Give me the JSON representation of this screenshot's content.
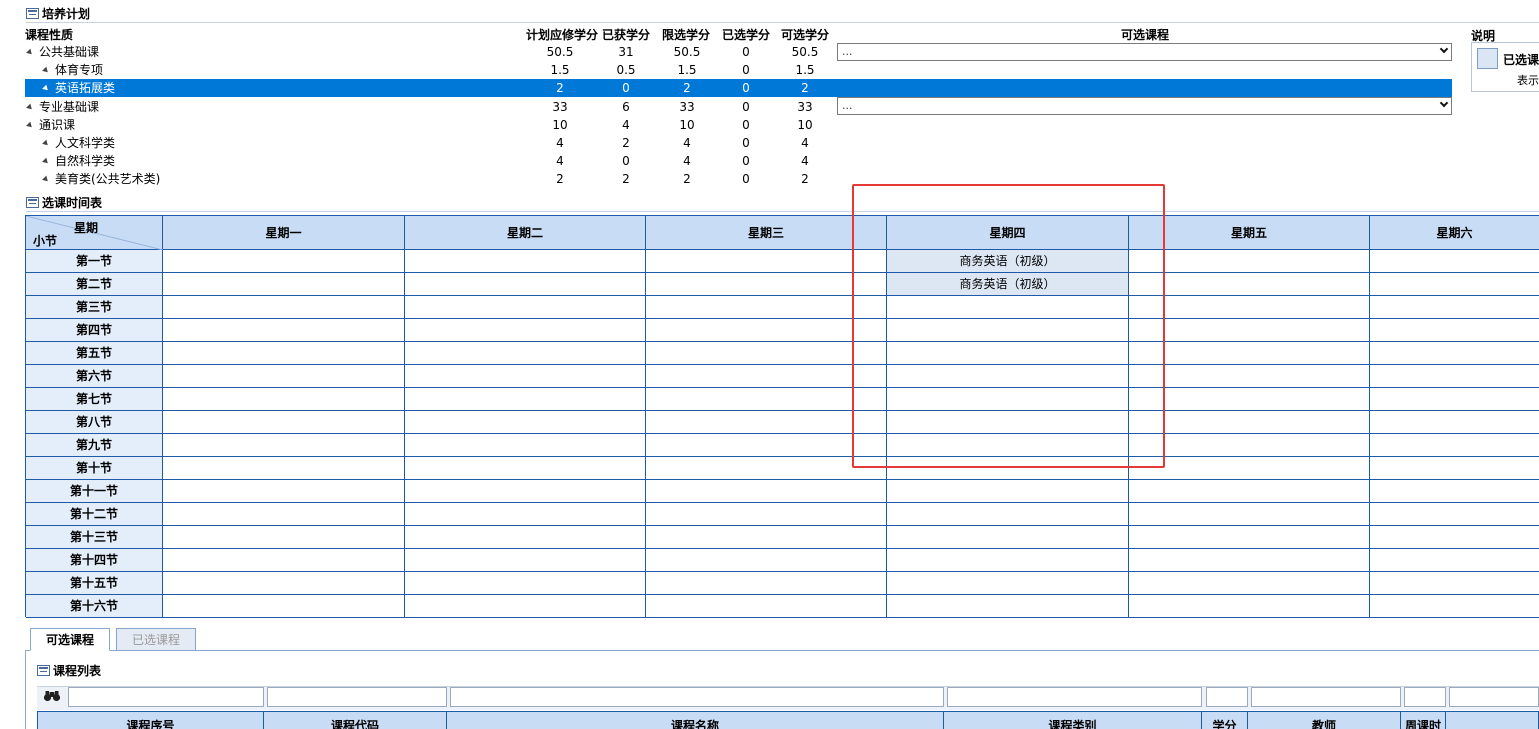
{
  "plan": {
    "title": "培养计划",
    "headers": {
      "category": "课程性质",
      "required": "计划应修学分",
      "earned": "已获学分",
      "limit": "限选学分",
      "selected": "已选学分",
      "available": "可选学分",
      "courses": "可选课程",
      "note": "说明"
    },
    "rows": [
      {
        "name": "公共基础课",
        "v": [
          "50.5",
          "31",
          "50.5",
          "0",
          "50.5"
        ]
      },
      {
        "name": "体育专项",
        "v": [
          "1.5",
          "0.5",
          "1.5",
          "0",
          "1.5"
        ]
      },
      {
        "name": "英语拓展类",
        "v": [
          "2",
          "0",
          "2",
          "0",
          "2"
        ]
      },
      {
        "name": "专业基础课",
        "v": [
          "33",
          "6",
          "33",
          "0",
          "33"
        ]
      },
      {
        "name": "通识课",
        "v": [
          "10",
          "4",
          "10",
          "0",
          "10"
        ]
      },
      {
        "name": "人文科学类",
        "v": [
          "4",
          "2",
          "4",
          "0",
          "4"
        ]
      },
      {
        "name": "自然科学类",
        "v": [
          "4",
          "0",
          "4",
          "0",
          "4"
        ]
      },
      {
        "name": "美育类(公共艺术类)",
        "v": [
          "2",
          "2",
          "2",
          "0",
          "2"
        ]
      }
    ],
    "dropdown1": "...",
    "dropdown2": "...",
    "legend": {
      "label": "已选课",
      "sub": "表示"
    }
  },
  "schedule": {
    "title": "选课时间表",
    "corner_top": "星期",
    "corner_bottom": "小节",
    "days": [
      "星期一",
      "星期二",
      "星期三",
      "星期四",
      "星期五",
      "星期六"
    ],
    "periods": [
      "第一节",
      "第二节",
      "第三节",
      "第四节",
      "第五节",
      "第六节",
      "第七节",
      "第八节",
      "第九节",
      "第十节",
      "第十一节",
      "第十二节",
      "第十三节",
      "第十四节",
      "第十五节",
      "第十六节"
    ],
    "course1": "商务英语（初级）",
    "course2": "商务英语（初级）"
  },
  "tabs": {
    "available": "可选课程",
    "chosen": "已选课程"
  },
  "course_list": {
    "title": "课程列表",
    "columns": [
      "课程序号",
      "课程代码",
      "课程名称",
      "课程类别",
      "学分",
      "教师",
      "周课时"
    ]
  },
  "highlight_color": "#e53935"
}
